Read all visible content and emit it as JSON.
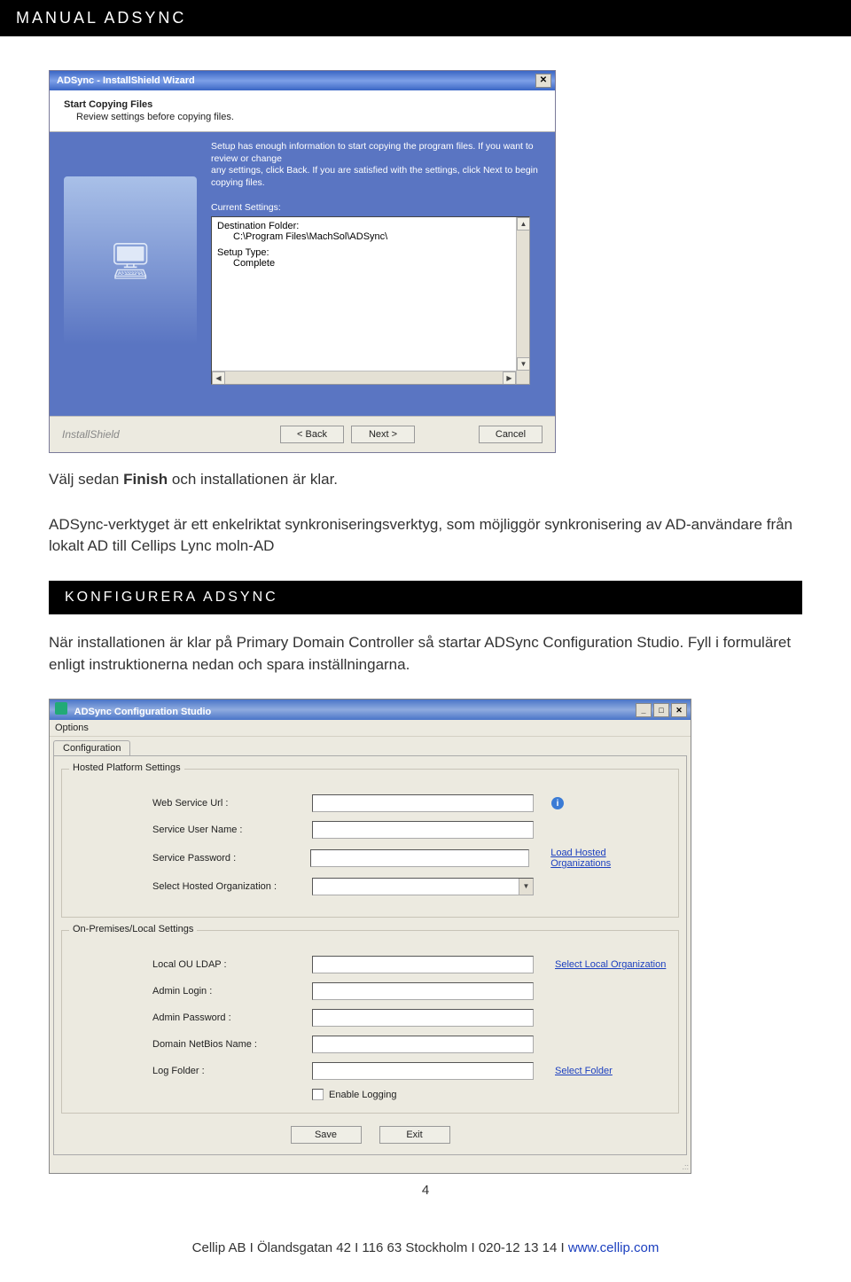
{
  "header": {
    "title": "MANUAL ADSYNC"
  },
  "wizard": {
    "title": "ADSync - InstallShield Wizard",
    "close_glyph": "✕",
    "h1": "Start Copying Files",
    "h2": "Review settings before copying files.",
    "instr1": "Setup has enough information to start copying the program files. If you want to review or change",
    "instr2": "any settings, click Back. If you are satisfied with the settings, click Next to begin copying files.",
    "current_settings_label": "Current Settings:",
    "dest_label": "Destination Folder:",
    "dest_value": "C:\\Program Files\\MachSol\\ADSync\\",
    "setup_type_label": "Setup Type:",
    "setup_type_value": "Complete",
    "brand": "InstallShield",
    "back_btn": "< Back",
    "next_btn": "Next >",
    "cancel_btn": "Cancel",
    "art_glyph": "🖥"
  },
  "para1_pre": "Välj sedan ",
  "para1_bold": "Finish",
  "para1_post": " och installationen är klar.",
  "para2": "ADSync-verktyget är ett enkelriktat synkroniseringsverktyg, som möjliggör synkronisering av AD-användare från lokalt AD till Cellips Lync moln-AD",
  "section2": {
    "title": "KONFIGURERA ADSYNC"
  },
  "para3": "När installationen är klar på Primary Domain Controller så startar ADSync Configuration Studio. Fyll i formuläret enligt instruktionerna nedan och spara inställningarna.",
  "config": {
    "title": "ADSync Configuration Studio",
    "minimize": "_",
    "maximize": "□",
    "close": "✕",
    "menu_options": "Options",
    "tab_config": "Configuration",
    "group_hosted": "Hosted Platform Settings",
    "group_local": "On-Premises/Local Settings",
    "labels": {
      "web_service_url": "Web Service Url :",
      "service_user_name": "Service User Name :",
      "service_password": "Service Password :",
      "select_hosted_org": "Select Hosted Organization :",
      "local_ou_ldap": "Local OU LDAP :",
      "admin_login": "Admin Login :",
      "admin_password": "Admin Password :",
      "domain_netbios": "Domain NetBios Name :",
      "log_folder": "Log Folder :"
    },
    "links": {
      "load_hosted": "Load Hosted Organizations",
      "select_local": "Select Local Organization",
      "select_folder": "Select Folder"
    },
    "enable_logging": "Enable Logging",
    "save_btn": "Save",
    "exit_btn": "Exit",
    "info_glyph": "i",
    "dd_glyph": "▼"
  },
  "footer": {
    "page_number": "4",
    "line_pre": "Cellip AB  I  Ölandsgatan 42  I  116 63 Stockholm  I  020-12 13 14  I  ",
    "link_text": "www.cellip.com"
  }
}
